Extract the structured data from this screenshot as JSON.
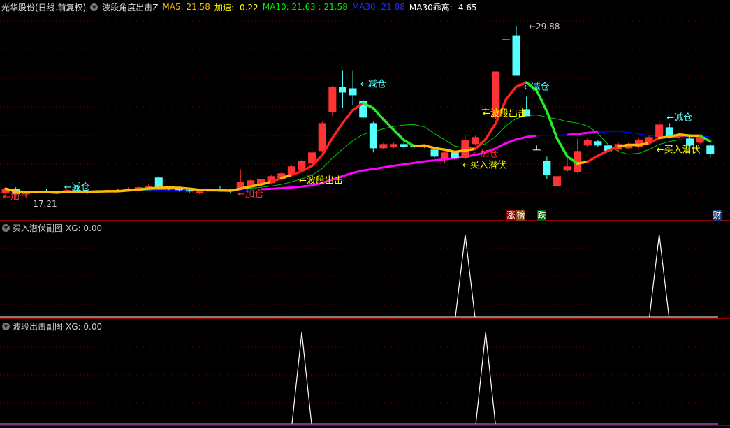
{
  "header": {
    "stock": "光华股份(日线.前复权)",
    "indicator": "波段角度出击Z",
    "ma5": "MA5: 21.58",
    "accel": "加速: -0.22",
    "ma10": "MA10: 21.63 : 21.58",
    "ma30": "MA30: 21.88",
    "ma30dev": "MA30乖离: -4.65"
  },
  "colors": {
    "up": "#ff3333",
    "down": "#54ffff",
    "ma10": "#00cc00",
    "ma30": "#0000ff",
    "ma30up": "#ff00ff",
    "grid": "#800000"
  },
  "markers": {
    "zhang": "涨",
    "bang": "榜",
    "die": "跌",
    "cai": "财"
  },
  "panels": [
    {
      "title": "买入潜伏副图",
      "value": "XG: 0.00"
    },
    {
      "title": "波段出击副图",
      "value": "XG: 0.00"
    }
  ],
  "chart_data": {
    "type": "candlestick",
    "price_range": [
      16.5,
      30.5
    ],
    "high_label": "29.88",
    "low_label": "17.21",
    "candles": [
      [
        17.9,
        18.3,
        17.6,
        18.2
      ],
      [
        18.2,
        18.3,
        17.7,
        17.8
      ],
      [
        17.8,
        18.0,
        17.6,
        17.9
      ],
      [
        17.9,
        18.1,
        17.8,
        18.0
      ],
      [
        18.0,
        18.2,
        17.9,
        17.9
      ],
      [
        17.9,
        18.0,
        17.8,
        18.0
      ],
      [
        18.0,
        18.2,
        17.9,
        18.1
      ],
      [
        18.1,
        18.2,
        17.9,
        17.9
      ],
      [
        17.9,
        18.1,
        17.8,
        18.0
      ],
      [
        18.0,
        18.1,
        17.9,
        18.0
      ],
      [
        18.0,
        18.2,
        17.9,
        18.1
      ],
      [
        18.1,
        18.2,
        18.0,
        18.1
      ],
      [
        18.1,
        18.3,
        18.0,
        18.2
      ],
      [
        18.2,
        18.4,
        18.1,
        18.3
      ],
      [
        18.3,
        18.5,
        18.2,
        18.4
      ],
      [
        19.0,
        19.1,
        18.2,
        18.3
      ],
      [
        18.3,
        18.4,
        18.1,
        18.2
      ],
      [
        18.2,
        18.3,
        18.0,
        18.1
      ],
      [
        18.1,
        18.2,
        17.9,
        18.0
      ],
      [
        17.9,
        18.1,
        17.8,
        18.0
      ],
      [
        18.0,
        18.3,
        17.9,
        18.2
      ],
      [
        18.2,
        18.4,
        18.0,
        18.1
      ],
      [
        18.1,
        18.2,
        17.9,
        18.0
      ],
      [
        18.2,
        19.6,
        18.1,
        18.7
      ],
      [
        18.4,
        18.9,
        18.3,
        18.8
      ],
      [
        18.5,
        19.0,
        18.4,
        18.9
      ],
      [
        18.6,
        19.2,
        18.5,
        19.1
      ],
      [
        18.9,
        19.4,
        18.8,
        19.3
      ],
      [
        19.2,
        19.9,
        19.1,
        19.8
      ],
      [
        19.5,
        20.3,
        19.4,
        20.2
      ],
      [
        20.0,
        21.5,
        19.9,
        20.8
      ],
      [
        20.9,
        23.0,
        20.8,
        22.9
      ],
      [
        23.7,
        25.6,
        23.4,
        25.5
      ],
      [
        25.5,
        26.7,
        24.0,
        25.1
      ],
      [
        25.4,
        26.7,
        24.2,
        24.9
      ],
      [
        24.5,
        24.6,
        23.2,
        23.3
      ],
      [
        22.9,
        23.0,
        20.8,
        21.1
      ],
      [
        21.1,
        21.5,
        21.0,
        21.4
      ],
      [
        21.2,
        21.5,
        21.1,
        21.4
      ],
      [
        21.4,
        21.5,
        21.1,
        21.2
      ],
      [
        21.3,
        21.4,
        21.1,
        21.2
      ],
      [
        21.2,
        21.4,
        21.1,
        21.3
      ],
      [
        21.0,
        21.1,
        20.4,
        20.5
      ],
      [
        20.4,
        20.9,
        20.0,
        20.8
      ],
      [
        20.8,
        20.9,
        20.3,
        20.4
      ],
      [
        20.4,
        22.0,
        20.3,
        21.7
      ],
      [
        21.4,
        22.0,
        21.3,
        21.9
      ],
      [
        23.9,
        24.0,
        23.8,
        23.9
      ],
      [
        23.3,
        26.6,
        23.2,
        26.6
      ],
      [
        28.9,
        29.0,
        28.9,
        28.9
      ],
      [
        29.2,
        29.88,
        26.3,
        26.3
      ],
      [
        23.9,
        24.8,
        23.4,
        23.4
      ],
      [
        21.0,
        21.3,
        21.0,
        21.0
      ],
      [
        20.2,
        20.5,
        18.9,
        19.2
      ],
      [
        18.4,
        19.6,
        17.6,
        19.1
      ],
      [
        19.5,
        20.6,
        19.4,
        19.8
      ],
      [
        19.4,
        21.8,
        19.3,
        20.9
      ],
      [
        21.3,
        21.8,
        21.2,
        21.7
      ],
      [
        21.6,
        21.7,
        21.2,
        21.3
      ],
      [
        21.3,
        21.4,
        20.8,
        20.9
      ],
      [
        21.0,
        21.5,
        20.8,
        21.4
      ],
      [
        21.1,
        21.5,
        21.0,
        21.4
      ],
      [
        21.2,
        21.8,
        21.1,
        21.7
      ],
      [
        21.5,
        22.0,
        21.4,
        21.9
      ],
      [
        21.9,
        23.1,
        21.8,
        22.8
      ],
      [
        22.6,
        22.9,
        21.8,
        21.9
      ],
      [
        21.9,
        22.2,
        21.8,
        22.1
      ],
      [
        21.8,
        22.1,
        21.2,
        21.3
      ],
      [
        21.5,
        22.0,
        21.4,
        21.9
      ],
      [
        21.3,
        21.4,
        20.4,
        20.7
      ]
    ],
    "annotations": [
      {
        "i": 0,
        "price": 17.4,
        "text": "←加仓",
        "color": "#ff3333"
      },
      {
        "i": 6,
        "price": 18.1,
        "text": "←减仓",
        "color": "#54ffff"
      },
      {
        "i": 23,
        "price": 17.6,
        "text": "←加仓",
        "color": "#ff3333"
      },
      {
        "i": 29,
        "price": 18.6,
        "text": "←波段出击",
        "color": "#ffff00"
      },
      {
        "i": 35,
        "price": 25.5,
        "text": "←减仓",
        "color": "#54ffff"
      },
      {
        "i": 45,
        "price": 19.7,
        "text": "←买入潜伏",
        "color": "#ffff00"
      },
      {
        "i": 46,
        "price": 20.5,
        "text": "←加仓",
        "color": "#ff3333"
      },
      {
        "i": 47,
        "price": 23.4,
        "text": "←波段出击",
        "color": "#ffff00"
      },
      {
        "i": 51,
        "price": 25.3,
        "text": "←减仓",
        "color": "#54ffff"
      },
      {
        "i": 64,
        "price": 20.8,
        "text": "←买入潜伏",
        "color": "#ffff00"
      },
      {
        "i": 65,
        "price": 23.1,
        "text": "←减仓",
        "color": "#54ffff"
      }
    ],
    "signal_buy": {
      "indices": [
        45,
        64
      ]
    },
    "signal_wave": {
      "indices": [
        29,
        47
      ]
    }
  }
}
